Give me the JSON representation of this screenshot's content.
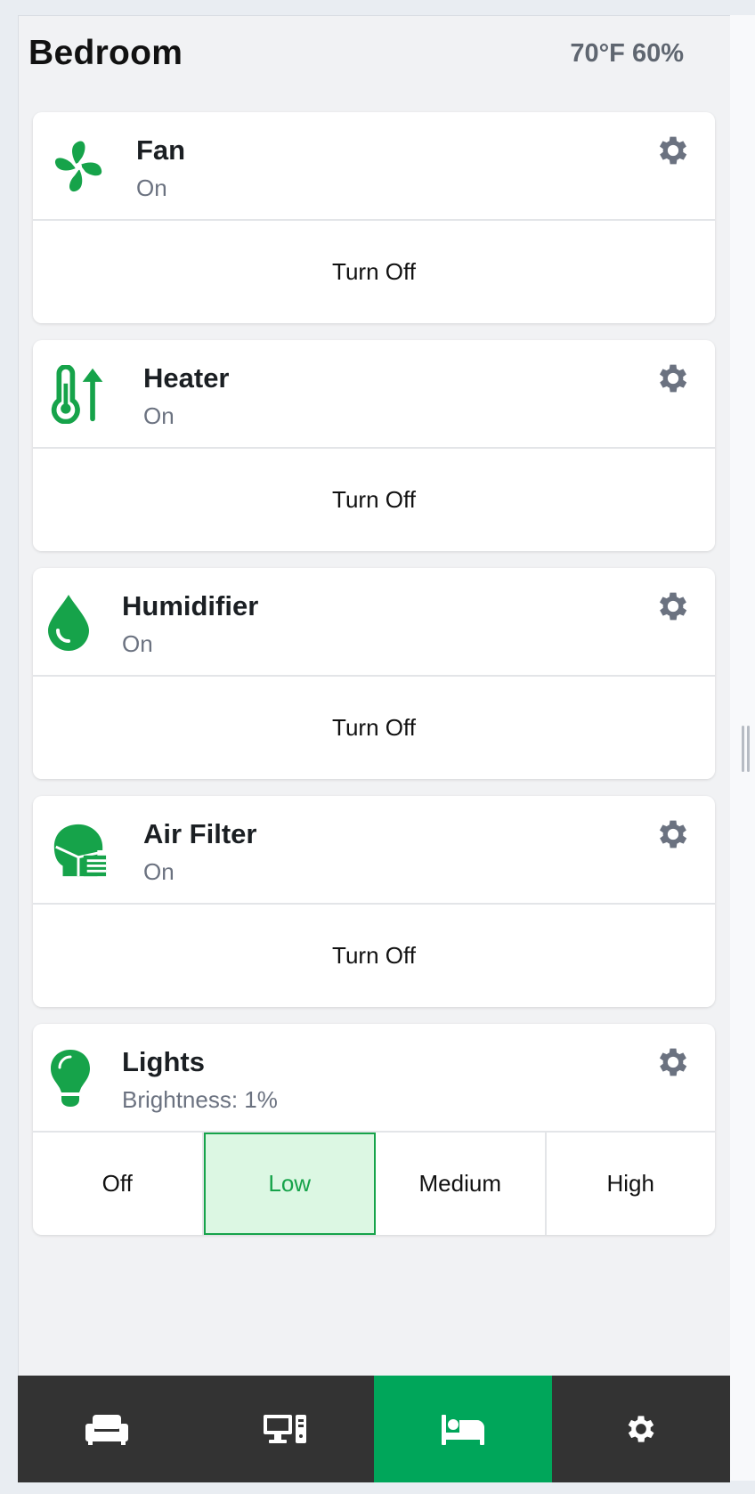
{
  "header": {
    "room_title": "Bedroom",
    "climate": "70°F 60%"
  },
  "colors": {
    "accent": "#16a34a",
    "tab_active": "#00a65a",
    "tabbar": "#333333",
    "gear": "#6b7280"
  },
  "devices": [
    {
      "name": "Fan",
      "status": "On",
      "icon": "fan-icon",
      "action_label": "Turn Off"
    },
    {
      "name": "Heater",
      "status": "On",
      "icon": "temperature-arrow-up-icon",
      "action_label": "Turn Off"
    },
    {
      "name": "Humidifier",
      "status": "On",
      "icon": "droplet-icon",
      "action_label": "Turn Off"
    },
    {
      "name": "Air Filter",
      "status": "On",
      "icon": "head-mask-icon",
      "action_label": "Turn Off"
    },
    {
      "name": "Lights",
      "status": "Brightness: 1%",
      "icon": "lightbulb-icon",
      "options": [
        "Off",
        "Low",
        "Medium",
        "High"
      ],
      "selected_option": "Low"
    }
  ],
  "tabs": [
    {
      "icon": "couch-icon",
      "active": false
    },
    {
      "icon": "computer-icon",
      "active": false
    },
    {
      "icon": "bed-icon",
      "active": true
    },
    {
      "icon": "gear-icon",
      "active": false
    }
  ]
}
